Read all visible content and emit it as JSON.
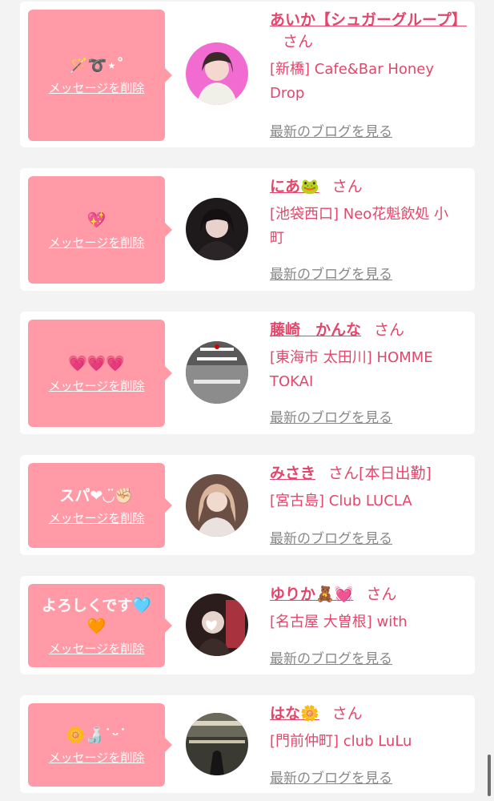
{
  "delete_label": "メッセージを削除",
  "blog_label": "最新のブログを見る",
  "colors": {
    "bubble": "#ff9aa6",
    "name": "#e4466b",
    "link_gray": "#888888",
    "card": "#ffffff",
    "background": "#f3f3f3"
  },
  "cards": [
    {
      "message": "🪄➰⋆˚",
      "name": "あいか【シュガーグループ】",
      "honorific": "さん",
      "status": "",
      "shop": "[新橋] Cafe&Bar Honey Drop"
    },
    {
      "message": "💖",
      "name": "にあ🐸",
      "honorific": "さん",
      "status": "",
      "shop": "[池袋西口] Neo花魁飲処 小町"
    },
    {
      "message": "💗💗💗",
      "name": "藤崎　かんな",
      "honorific": "さん",
      "status": "",
      "shop": "[東海市 太田川] HOMME TOKAI"
    },
    {
      "message": "スパ❤︎◡̈✊🏻",
      "name": "みさき",
      "honorific": "さん",
      "status": "[本日出勤]",
      "shop": "[宮古島] Club LUCLA"
    },
    {
      "message": "よろしくです🩵🧡",
      "name": "ゆりか🧸💓",
      "honorific": "さん",
      "status": "",
      "shop": "[名古屋 大曽根] with"
    },
    {
      "message": "🌼🍶˙ᵕ˙",
      "name": "はな🌼",
      "honorific": "さん",
      "status": "",
      "shop": "[門前仲町] club LuLu"
    }
  ]
}
